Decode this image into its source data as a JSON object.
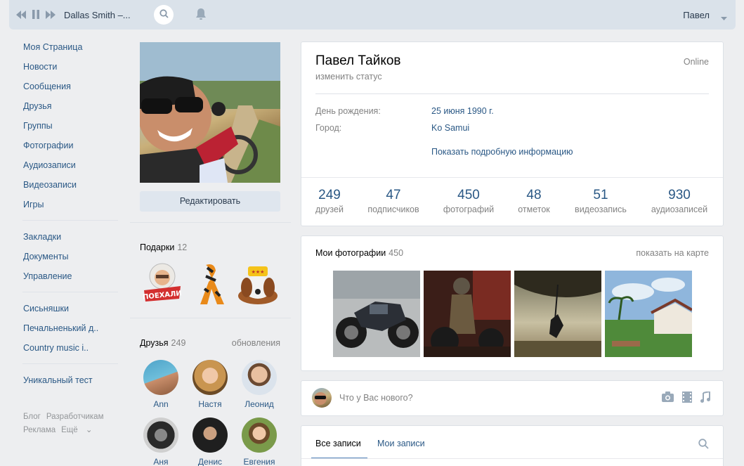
{
  "header": {
    "track": "Dallas Smith –...",
    "user": "Павел"
  },
  "menu": {
    "group1": [
      "Моя Страница",
      "Новости",
      "Сообщения",
      "Друзья",
      "Группы",
      "Фотографии",
      "Аудиозаписи",
      "Видеозаписи",
      "Игры"
    ],
    "group2": [
      "Закладки",
      "Документы",
      "Управление"
    ],
    "group3": [
      "Сисьняшки",
      "Печальненький д..",
      "Country music i.."
    ],
    "group4": [
      "Уникальный тест"
    ]
  },
  "footer": {
    "blog": "Блог",
    "devs": "Разработчикам",
    "ads": "Реклама",
    "more": "Ещё"
  },
  "profile": {
    "edit_button": "Редактировать",
    "name": "Павел Тайков",
    "status": "изменить статус",
    "online": "Online",
    "birthday_label": "День рождения:",
    "birthday_value": "25 июня 1990 г.",
    "city_label": "Город:",
    "city_value": "Ko Samui",
    "more_info": "Показать подробную информацию",
    "counters": [
      {
        "num": "249",
        "label": "друзей"
      },
      {
        "num": "47",
        "label": "подписчиков"
      },
      {
        "num": "450",
        "label": "фотографий"
      },
      {
        "num": "48",
        "label": "отметок"
      },
      {
        "num": "51",
        "label": "видеозапись"
      },
      {
        "num": "930",
        "label": "аудиозаписей"
      }
    ]
  },
  "gifts": {
    "title": "Подарки",
    "count": "12"
  },
  "friends": {
    "title": "Друзья",
    "count": "249",
    "updates": "обновления",
    "list": [
      "Ann",
      "Настя",
      "Леонид",
      "Аня",
      "Денис",
      "Евгения"
    ]
  },
  "photos": {
    "title": "Мои фотографии",
    "count": "450",
    "map_link": "показать на карте"
  },
  "post": {
    "placeholder": "Что у Вас нового?"
  },
  "wall": {
    "tab_all": "Все записи",
    "tab_mine": "Мои записи"
  },
  "colors": {
    "link": "#2a5885",
    "header_bg": "#dae2ea",
    "page_bg": "#edeef0",
    "accent": "#5181b8"
  }
}
